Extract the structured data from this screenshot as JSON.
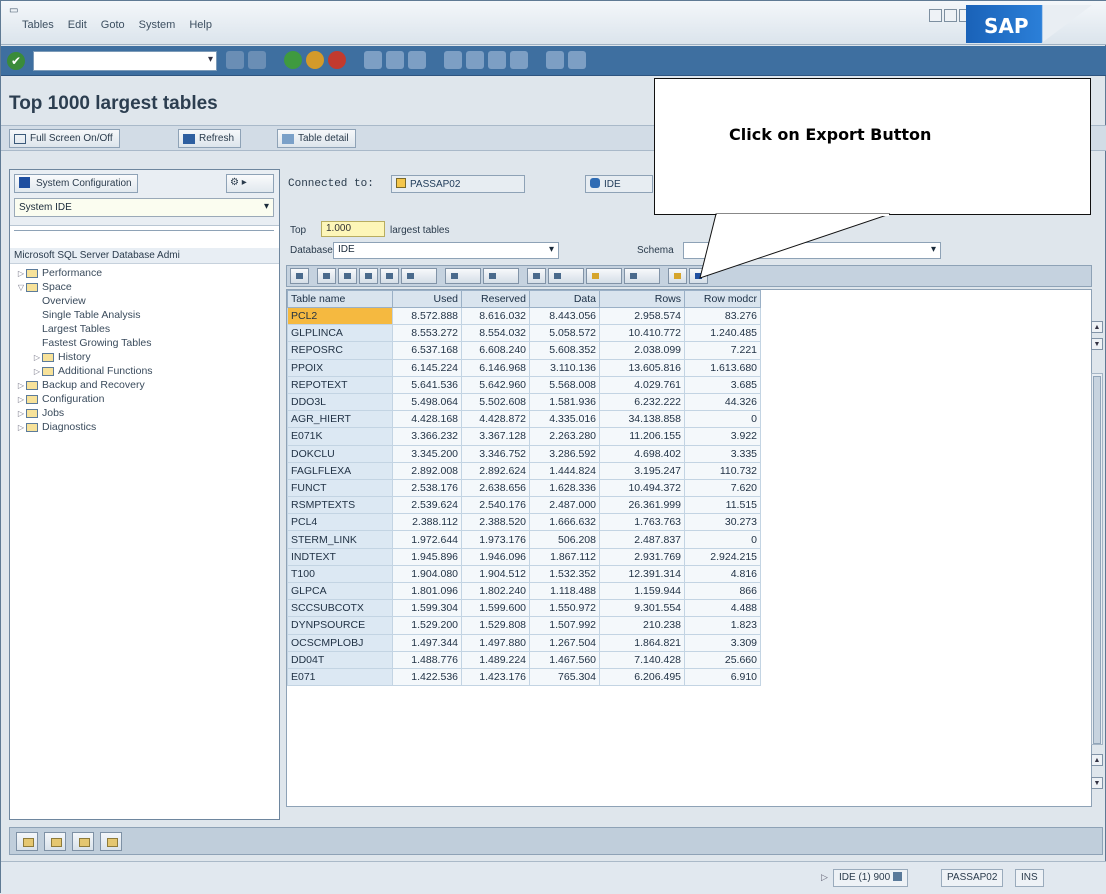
{
  "menu": [
    "Tables",
    "Edit",
    "Goto",
    "System",
    "Help"
  ],
  "brand": "SAP",
  "page_title": "Top 1000 largest tables",
  "app_toolbar": {
    "fullscreen": "Full Screen On/Off",
    "refresh": "Refresh",
    "table_detail": "Table detail"
  },
  "nav": {
    "tab_label": "System Configuration",
    "system_field": "System IDE",
    "header": "Microsoft SQL Server Database Admi",
    "tree": [
      {
        "label": "Performance",
        "level": 0,
        "type": "folder",
        "expanded": false
      },
      {
        "label": "Space",
        "level": 0,
        "type": "folder",
        "expanded": true
      },
      {
        "label": "Overview",
        "level": 1,
        "type": "leaf"
      },
      {
        "label": "Single Table Analysis",
        "level": 1,
        "type": "leaf"
      },
      {
        "label": "Largest Tables",
        "level": 1,
        "type": "leaf"
      },
      {
        "label": "Fastest Growing Tables",
        "level": 1,
        "type": "leaf"
      },
      {
        "label": "History",
        "level": 1,
        "type": "folder",
        "expanded": false
      },
      {
        "label": "Additional Functions",
        "level": 1,
        "type": "folder",
        "expanded": false
      },
      {
        "label": "Backup and Recovery",
        "level": 0,
        "type": "folder",
        "expanded": false
      },
      {
        "label": "Configuration",
        "level": 0,
        "type": "folder",
        "expanded": false
      },
      {
        "label": "Jobs",
        "level": 0,
        "type": "folder",
        "expanded": false
      },
      {
        "label": "Diagnostics",
        "level": 0,
        "type": "folder",
        "expanded": false
      }
    ]
  },
  "connected_to_label": "Connected to:",
  "connected_to_value": "PASSAP02",
  "system_value": "IDE",
  "top_label": "Top",
  "top_value": "1.000",
  "top_suffix": "largest tables",
  "database_label": "Database",
  "database_value": "IDE",
  "schema_label": "Schema",
  "schema_value": "",
  "table": {
    "columns": [
      "Table name",
      "Used",
      "Reserved",
      "Data",
      "Rows",
      "Row modcr"
    ],
    "rows": [
      [
        "PCL2",
        "8.572.888",
        "8.616.032",
        "8.443.056",
        "2.958.574",
        "83.276"
      ],
      [
        "GLPLINCA",
        "8.553.272",
        "8.554.032",
        "5.058.572",
        "10.410.772",
        "1.240.485"
      ],
      [
        "REPOSRC",
        "6.537.168",
        "6.608.240",
        "5.608.352",
        "2.038.099",
        "7.221"
      ],
      [
        "PPOIX",
        "6.145.224",
        "6.146.968",
        "3.110.136",
        "13.605.816",
        "1.613.680"
      ],
      [
        "REPOTEXT",
        "5.641.536",
        "5.642.960",
        "5.568.008",
        "4.029.761",
        "3.685"
      ],
      [
        "DDO3L",
        "5.498.064",
        "5.502.608",
        "1.581.936",
        "6.232.222",
        "44.326"
      ],
      [
        "AGR_HIERT",
        "4.428.168",
        "4.428.872",
        "4.335.016",
        "34.138.858",
        "0"
      ],
      [
        "E071K",
        "3.366.232",
        "3.367.128",
        "2.263.280",
        "11.206.155",
        "3.922"
      ],
      [
        "DOKCLU",
        "3.345.200",
        "3.346.752",
        "3.286.592",
        "4.698.402",
        "3.335"
      ],
      [
        "FAGLFLEXA",
        "2.892.008",
        "2.892.624",
        "1.444.824",
        "3.195.247",
        "110.732"
      ],
      [
        "FUNCT",
        "2.538.176",
        "2.638.656",
        "1.628.336",
        "10.494.372",
        "7.620"
      ],
      [
        "RSMPTEXTS",
        "2.539.624",
        "2.540.176",
        "2.487.000",
        "26.361.999",
        "11.515"
      ],
      [
        "PCL4",
        "2.388.112",
        "2.388.520",
        "1.666.632",
        "1.763.763",
        "30.273"
      ],
      [
        "STERM_LINK",
        "1.972.644",
        "1.973.176",
        "506.208",
        "2.487.837",
        "0"
      ],
      [
        "INDTEXT",
        "1.945.896",
        "1.946.096",
        "1.867.112",
        "2.931.769",
        "2.924.215"
      ],
      [
        "T100",
        "1.904.080",
        "1.904.512",
        "1.532.352",
        "12.391.314",
        "4.816"
      ],
      [
        "GLPCA",
        "1.801.096",
        "1.802.240",
        "1.118.488",
        "1.159.944",
        "866"
      ],
      [
        "SCCSUBCOTX",
        "1.599.304",
        "1.599.600",
        "1.550.972",
        "9.301.554",
        "4.488"
      ],
      [
        "DYNPSOURCE",
        "1.529.200",
        "1.529.808",
        "1.507.992",
        "210.238",
        "1.823"
      ],
      [
        "OCSCMPLOBJ",
        "1.497.344",
        "1.497.880",
        "1.267.504",
        "1.864.821",
        "3.309"
      ],
      [
        "DD04T",
        "1.488.776",
        "1.489.224",
        "1.467.560",
        "7.140.428",
        "25.660"
      ],
      [
        "E071",
        "1.422.536",
        "1.423.176",
        "765.304",
        "6.206.495",
        "6.910"
      ]
    ]
  },
  "status": {
    "session": "IDE (1) 900",
    "server": "PASSAP02",
    "mode": "INS"
  },
  "callout": "Click on Export Button"
}
